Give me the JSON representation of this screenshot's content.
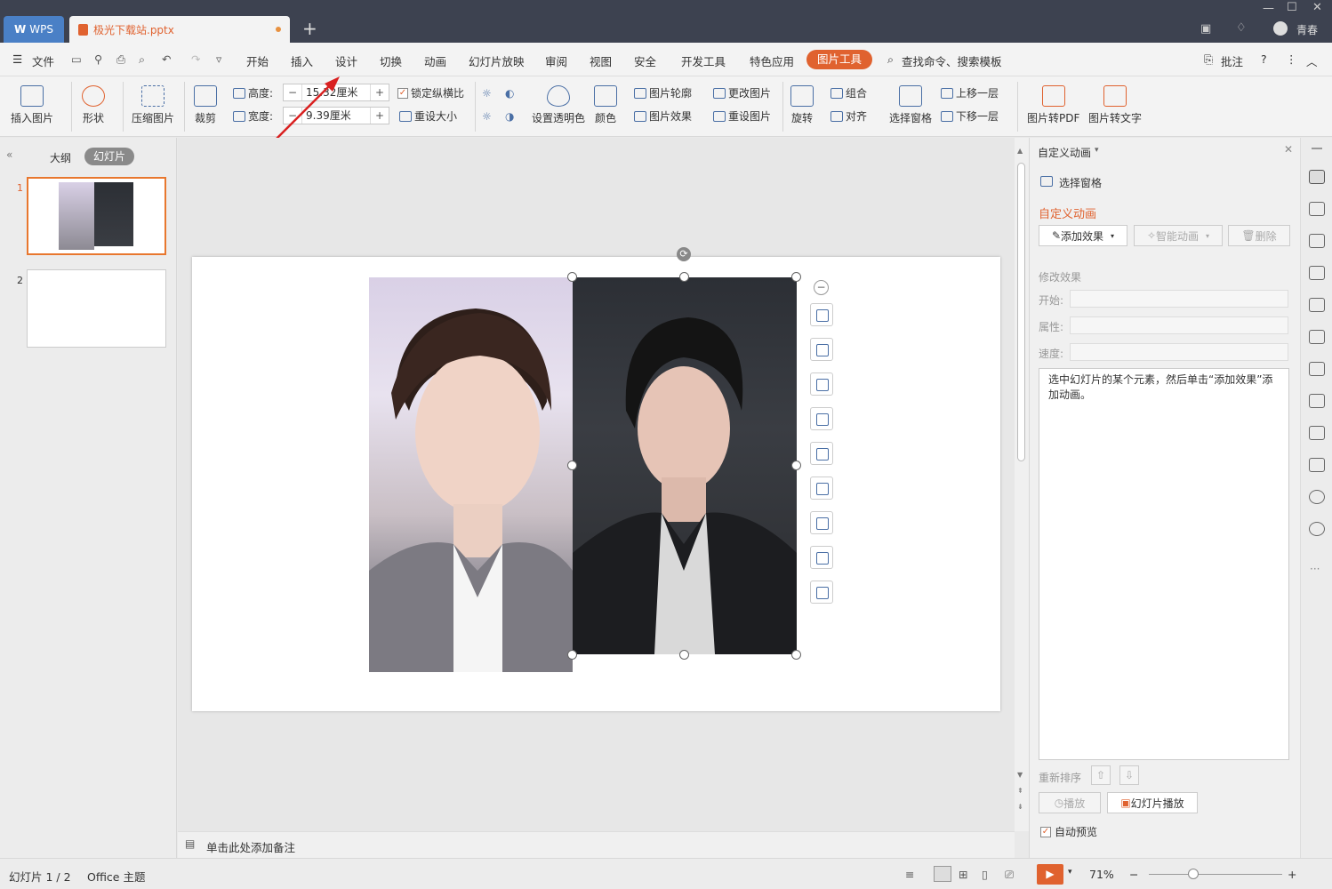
{
  "titlebar": {
    "wps_label": "WPS",
    "doc_tab": "极光下载站.pptx",
    "new_tab": "+",
    "user_name": "青春"
  },
  "menubar": {
    "file": "文件",
    "tabs": [
      "开始",
      "插入",
      "设计",
      "切换",
      "动画",
      "幻灯片放映",
      "审阅",
      "视图",
      "安全",
      "开发工具",
      "特色应用"
    ],
    "active_tab": "图片工具",
    "search": "查找命令、搜索模板",
    "comment": "批注",
    "help": "?"
  },
  "ribbon": {
    "insert_picture": "插入图片",
    "shape": "形状",
    "compress": "压缩图片",
    "crop": "裁剪",
    "height_label": "高度:",
    "height_value": "15.32厘米",
    "width_label": "宽度:",
    "width_value": "9.39厘米",
    "lock_ratio": "锁定纵横比",
    "reset_size": "重设大小",
    "set_transparent": "设置透明色",
    "color": "颜色",
    "outline": "图片轮廓",
    "effect": "图片效果",
    "change_picture": "更改图片",
    "reset_picture": "重设图片",
    "rotate": "旋转",
    "group": "组合",
    "align": "对齐",
    "select_pane": "选择窗格",
    "bring_forward": "上移一层",
    "send_backward": "下移一层",
    "to_pdf": "图片转PDF",
    "to_text": "图片转文字"
  },
  "leftpanel": {
    "outline_tab": "大纲",
    "slides_tab": "幻灯片",
    "slide_numbers": [
      "1",
      "2"
    ]
  },
  "notes": {
    "placeholder": "单击此处添加备注"
  },
  "rightpanel": {
    "title": "自定义动画",
    "select_pane": "选择窗格",
    "section_title": "自定义动画",
    "add_effect": "添加效果",
    "smart_anim": "智能动画",
    "delete": "删除",
    "modify": "修改效果",
    "start_label": "开始:",
    "property_label": "属性:",
    "speed_label": "速度:",
    "hint": "选中幻灯片的某个元素，然后单击“添加效果”添加动画。",
    "reorder": "重新排序",
    "play": "播放",
    "slideshow": "幻灯片播放",
    "autopreview": "自动预览"
  },
  "statusbar": {
    "slide_info": "幻灯片 1 / 2",
    "theme": "Office 主题",
    "zoom": "71%",
    "accent_color": "#e0622f"
  }
}
